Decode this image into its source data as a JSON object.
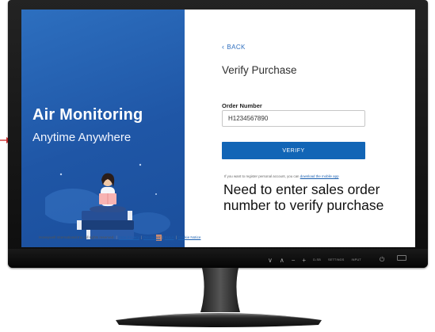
{
  "hero": {
    "title": "Air Monitoring",
    "subtitle": "Anytime Anywhere"
  },
  "form": {
    "back_label": "BACK",
    "page_title": "Verify Purchase",
    "field_label": "Order Number",
    "order_number_value": "H1234567890",
    "verify_label": "VERIFY",
    "register_note": "If you want to register personal account, you can ",
    "register_link": "download the mobile app"
  },
  "annotation": {
    "text": "Need to enter sales order number to verify purchase"
  },
  "footer": {
    "copyright": "Honeywell International Inc. All rights reserved.",
    "links": [
      "Data Privacy",
      "Disclaimer",
      "EULA",
      "Cookie Notice"
    ]
  },
  "monitor_controls": {
    "buttons": [
      "∨",
      "∧",
      "−",
      "+"
    ],
    "labels": [
      "D-SB",
      "SETTINGS",
      "INPUT"
    ],
    "power": "⏻"
  },
  "colors": {
    "hero_blue": "#1f56a6",
    "verify_button": "#1265b6",
    "link": "#1a5fb0",
    "arrow": "#d03030"
  },
  "icons": {
    "back": "chevron-left-icon",
    "arrow": "red-pointer-arrow-icon"
  }
}
